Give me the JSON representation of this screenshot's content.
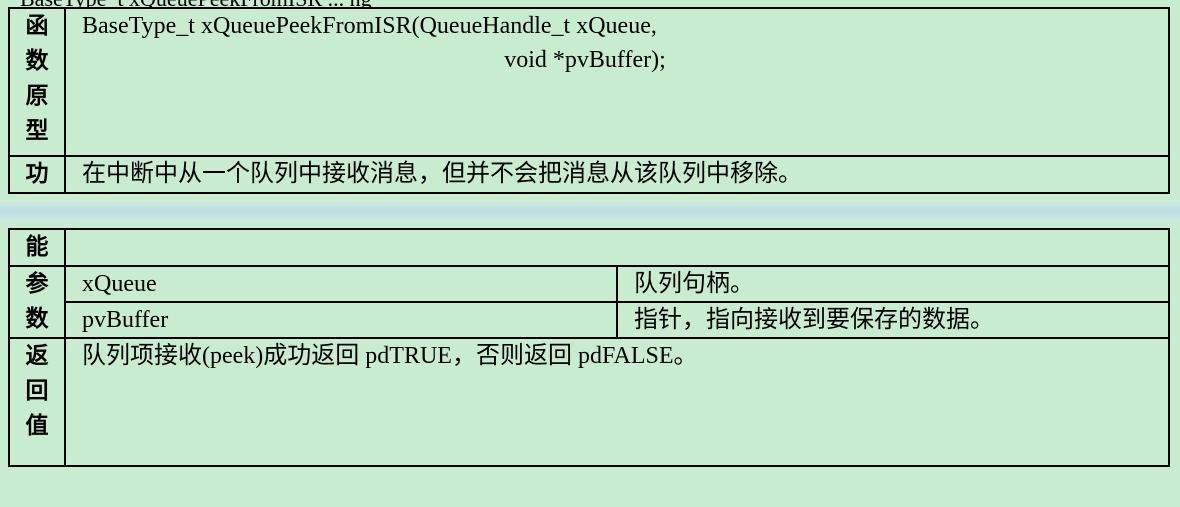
{
  "header_partial": "BaseType_t xQueuePeekFromISR ... ng",
  "table1": {
    "prototype_label": [
      "函",
      "数",
      "原",
      "型"
    ],
    "prototype_line1": "BaseType_t xQueuePeekFromISR(QueueHandle_t xQueue,",
    "prototype_line2": "void *pvBuffer);",
    "function_label_1": "功",
    "function_text": "在中断中从一个队列中接收消息，但并不会把消息从该队列中移除。"
  },
  "table2": {
    "function_label_2": "能",
    "params_label": [
      "参",
      "数"
    ],
    "params": [
      {
        "name": "xQueue",
        "desc": "队列句柄。"
      },
      {
        "name": "pvBuffer",
        "desc": "指针，指向接收到要保存的数据。"
      }
    ],
    "return_label": [
      "返",
      "回",
      "值"
    ],
    "return_text": "队列项接收(peek)成功返回 pdTRUE，否则返回 pdFALSE。"
  }
}
